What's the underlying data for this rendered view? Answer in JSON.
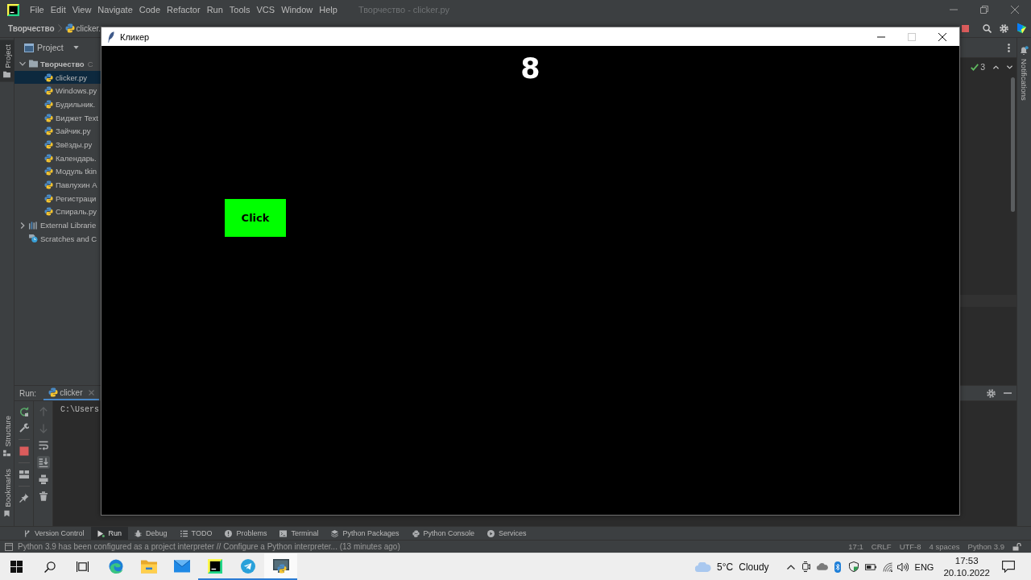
{
  "ide": {
    "menu": [
      "File",
      "Edit",
      "View",
      "Navigate",
      "Code",
      "Refactor",
      "Run",
      "Tools",
      "VCS",
      "Window",
      "Help"
    ],
    "title": "Творчество - clicker.py",
    "breadcrumb": [
      "Творчество",
      "clicker."
    ],
    "left_tabs_top": [
      {
        "kind": "project",
        "label": "Project",
        "selected": true
      }
    ],
    "left_tabs_bottom": [
      {
        "kind": "structure",
        "label": "Structure",
        "selected": false
      },
      {
        "kind": "bookmarks",
        "label": "Bookmarks",
        "selected": false
      }
    ],
    "project_panel": {
      "title": "Project",
      "tree": [
        {
          "kind": "folder",
          "label": "Творчество",
          "path": "C",
          "expanded": true,
          "selected": false,
          "children": [
            {
              "kind": "file",
              "label": "clicker.py",
              "selected": true
            },
            {
              "kind": "file",
              "label": "Windows.py",
              "selected": false
            },
            {
              "kind": "file",
              "label": "Будильник.",
              "selected": false
            },
            {
              "kind": "file",
              "label": "Виджет Text",
              "selected": false
            },
            {
              "kind": "file",
              "label": "Зайчик.py",
              "selected": false
            },
            {
              "kind": "file",
              "label": "Звёзды.py",
              "selected": false
            },
            {
              "kind": "file",
              "label": "Календарь.",
              "selected": false
            },
            {
              "kind": "file",
              "label": "Модуль tkin",
              "selected": false
            },
            {
              "kind": "file",
              "label": "Павлухин А",
              "selected": false
            },
            {
              "kind": "file",
              "label": "Регистраци",
              "selected": false
            },
            {
              "kind": "file",
              "label": "Спираль.py",
              "selected": false
            }
          ]
        },
        {
          "kind": "library",
          "label": "External Librarie",
          "expanded": false,
          "selected": false
        },
        {
          "kind": "scratches",
          "label": "Scratches and C",
          "selected": false
        }
      ]
    },
    "editor": {
      "problems": "3"
    },
    "notifications": "Notifications",
    "run_panel": {
      "label": "Run:",
      "tab": "clicker",
      "console": "C:\\Users",
      "tools": [
        {
          "kind": "up",
          "disabled": true,
          "on": false
        },
        {
          "kind": "down",
          "disabled": true,
          "on": false
        },
        {
          "kind": "wrap",
          "disabled": false,
          "on": false
        },
        {
          "kind": "scroll-end",
          "disabled": false,
          "on": true
        },
        {
          "kind": "print",
          "disabled": false,
          "on": false
        },
        {
          "kind": "trash",
          "disabled": false,
          "on": false
        }
      ]
    },
    "tool_windows": [
      {
        "kind": "vcs",
        "label": "Version Control",
        "selected": false
      },
      {
        "kind": "run",
        "label": "Run",
        "selected": true
      },
      {
        "kind": "debug",
        "label": "Debug",
        "selected": false
      },
      {
        "kind": "todo",
        "label": "TODO",
        "selected": false
      },
      {
        "kind": "problems",
        "label": "Problems",
        "selected": false
      },
      {
        "kind": "terminal",
        "label": "Terminal",
        "selected": false
      },
      {
        "kind": "packages",
        "label": "Python Packages",
        "selected": false
      },
      {
        "kind": "console",
        "label": "Python Console",
        "selected": false
      },
      {
        "kind": "services",
        "label": "Services",
        "selected": false
      }
    ],
    "status": {
      "message": "Python 3.9 has been configured as a project interpreter // Configure a Python interpreter... (13 minutes ago)",
      "items": [
        "17:1",
        "CRLF",
        "UTF-8",
        "4 spaces",
        "Python 3.9"
      ]
    }
  },
  "app_window": {
    "title": "Кликер",
    "controls": [
      {
        "kind": "minimize",
        "disabled": false
      },
      {
        "kind": "maximize",
        "disabled": true
      },
      {
        "kind": "close",
        "disabled": false
      }
    ],
    "score": "8",
    "button": "Click"
  },
  "taskbar": {
    "apps": [
      {
        "kind": "browser",
        "running": false,
        "selected": false
      },
      {
        "kind": "explorer",
        "running": false,
        "selected": false
      },
      {
        "kind": "mail",
        "running": false,
        "selected": false
      },
      {
        "kind": "ide",
        "running": true,
        "selected": false
      },
      {
        "kind": "messenger",
        "running": true,
        "selected": false
      },
      {
        "kind": "python",
        "running": true,
        "selected": true
      }
    ],
    "weather": {
      "temperature": "5°C",
      "condition": "Cloudy"
    },
    "language": "ENG",
    "time": "17:53",
    "date": "20.10.2022"
  }
}
